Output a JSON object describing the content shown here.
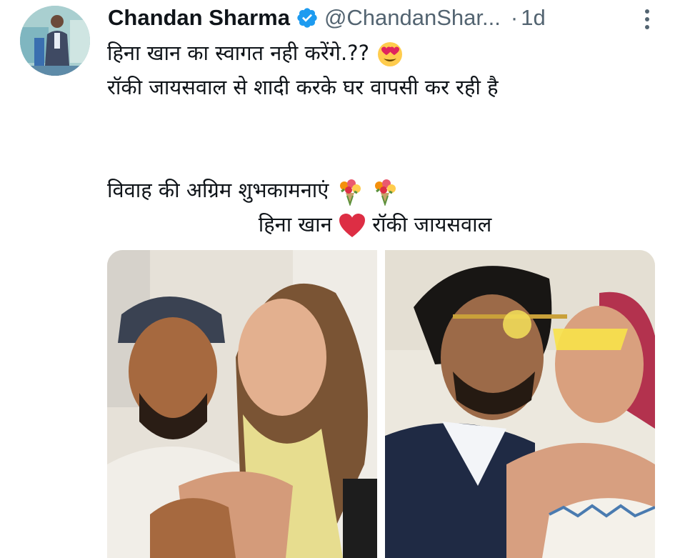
{
  "tweet": {
    "author_name": "Chandan Sharma",
    "handle": "@ChandanShar...",
    "separator": "·",
    "time": "1d",
    "verified": true,
    "lines": [
      "हिना खान का स्वागत नही करेंगे.??",
      "रॉकी जायसवाल से शादी करके घर वापसी कर रही है",
      "",
      "विवाह की अग्रिम शुभकामनाएं"
    ],
    "caption_left": "हिना खान",
    "caption_right": "रॉकी जायसवाल",
    "emojis": {
      "line1": "heart-eyes-emoji",
      "line4": [
        "bouquet-emoji",
        "bouquet-emoji"
      ],
      "caption": "red-heart-emoji"
    },
    "media": [
      {
        "name": "photo-couple-left"
      },
      {
        "name": "photo-couple-right"
      }
    ]
  },
  "colors": {
    "text": "#0f1419",
    "secondary": "#536471",
    "verified": "#1d9bf0",
    "heart": "#e0245e"
  }
}
